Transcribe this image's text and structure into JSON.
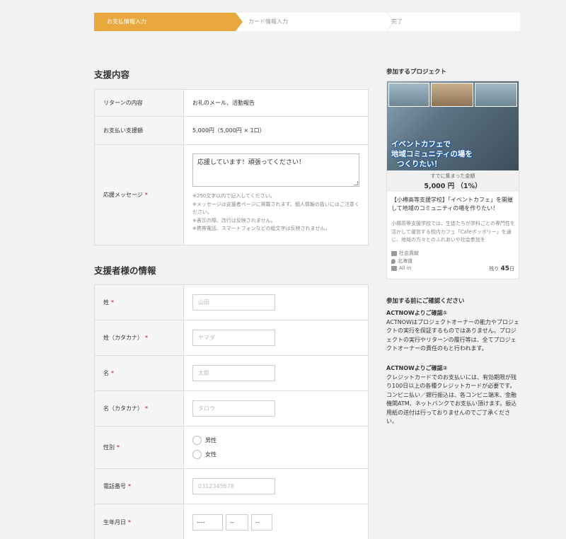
{
  "steps": [
    "お支払情報入力",
    "カード情報入力",
    "完了"
  ],
  "support": {
    "title": "支援内容",
    "return_label": "リターンの内容",
    "return_value": "お礼のメール、活動報告",
    "amount_label": "お支払い支援額",
    "amount_value": "5,000円（5,000円 × 1口）",
    "message_label": "応援メッセージ",
    "message_value": "応援しています！頑張ってください！",
    "notes": [
      "※250文字以内で記入してください。",
      "※メッセージは支援者ページに掲載されます。個人情報の扱いにはご注意ください。",
      "※表示の際、改行は反映されません。",
      "※携帯電話、スマートフォンなどの絵文字は反映されません。"
    ]
  },
  "supporter": {
    "title": "支援者様の情報",
    "last_name_label": "姓",
    "last_name_placeholder": "山田",
    "last_name_kana_label": "姓（カタカナ）",
    "last_name_kana_placeholder": "ヤマダ",
    "first_name_label": "名",
    "first_name_placeholder": "太郎",
    "first_name_kana_label": "名（カタカナ）",
    "first_name_kana_placeholder": "タロウ",
    "gender_label": "性別",
    "gender_male": "男性",
    "gender_female": "女性",
    "phone_label": "電話番号",
    "phone_placeholder": "0312345678",
    "birth_label": "生年月日",
    "birth_year": "----",
    "birth_month": "--",
    "birth_day": "--",
    "required_mark": "*"
  },
  "project": {
    "heading": "参加するプロジェクト",
    "image_caption_1": "イベントカフェで",
    "image_caption_2": "地域コミュニティの場を",
    "image_caption_3": "つくりたい！",
    "collected_label": "すでに集まった金額",
    "collected_value": "5,000 円 （1%）",
    "title": "【小樽高等支援学校】「イベントカフェ」を開催して地域のコミュニティの場を作りたい！",
    "description": "小樽高等支援学校では、生徒たちが学科ごとの専門性を活かして運営する校内カフェ「Cafeポッポリー」を通じ、地域の方々とのふれあいや社会参加を",
    "category": "社会貢献",
    "region": "北海道",
    "type": "All in",
    "days_prefix": "残り",
    "days_value": "45",
    "days_suffix": "日"
  },
  "confirm": {
    "heading": "参加する前にご確認ください",
    "h1": "ACTNOWよりご確認①",
    "p1": "ACTNOWはプロジェクトオーナーの能力やプロジェクトの実行を保証するものではありません。プロジェクトの実行やリターンの履行等は、全てプロジェクトオーナーの責任のもと行われます。",
    "h2": "ACTNOWよりご確認②",
    "p2": "クレジットカードでのお支払いには、有効期限が残り100日以上の各種クレジットカードが必要です。コンビニ払い／銀行振込は、各コンビニ端末、金融機関ATM、ネットバンクでお支払い頂けます。振込用紙の送付は行っておりませんのでご了承ください。"
  },
  "colors": {
    "accent": "#e8a83e",
    "required": "#d0021b"
  }
}
